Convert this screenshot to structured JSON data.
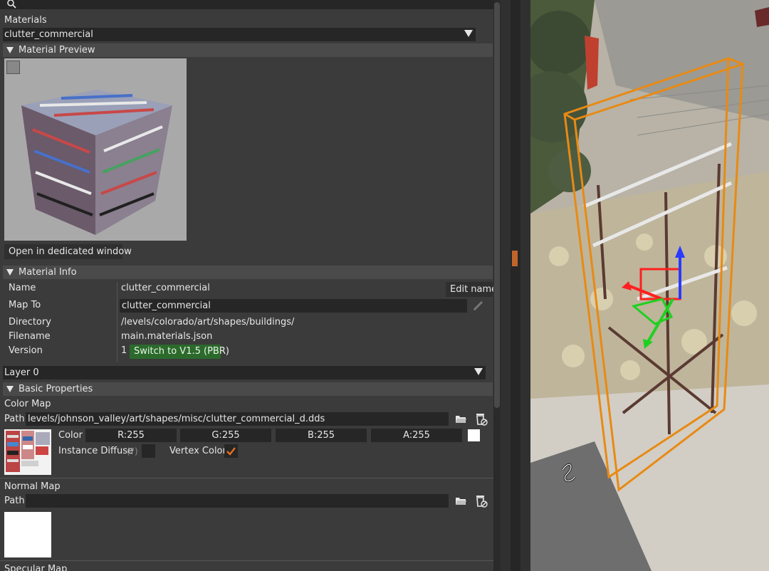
{
  "search": {
    "icon": "search-icon",
    "value": ""
  },
  "materials": {
    "label": "Materials",
    "selected": "clutter_commercial"
  },
  "preview": {
    "header": "Material Preview",
    "open_button": "Open in dedicated window"
  },
  "info": {
    "header": "Material Info",
    "name_label": "Name",
    "name_value": "clutter_commercial",
    "edit_name": "Edit name",
    "mapto_label": "Map To",
    "mapto_value": "clutter_commercial",
    "dir_label": "Directory",
    "dir_value": "/levels/colorado/art/shapes/buildings/",
    "file_label": "Filename",
    "file_value": "main.materials.json",
    "version_label": "Version",
    "version_value": "1",
    "switch_button": "Switch to V1.5 (PBR)"
  },
  "layer": {
    "selected": "Layer 0"
  },
  "basic": {
    "header": "Basic Properties",
    "color_map": {
      "title": "Color Map",
      "path_label": "Path",
      "path_value": "levels/johnson_valley/art/shapes/misc/clutter_commercial_d.dds",
      "color_label": "Color",
      "r": "R:255",
      "g": "G:255",
      "b": "B:255",
      "a": "A:255",
      "instance_diffuse": "Instance Diffuse",
      "help": "(?)",
      "vertex_color": "Vertex Color",
      "vertex_checked": true
    },
    "normal_map": {
      "title": "Normal Map",
      "path_label": "Path",
      "path_value": ""
    },
    "specular_map": {
      "title": "Specular Map"
    }
  },
  "colors": {
    "panel": "#3b3b3b",
    "field": "#262626",
    "header": "#4a4a4a",
    "accent_green": "#2b6a2b",
    "gizmo_orange": "#e88a14"
  }
}
